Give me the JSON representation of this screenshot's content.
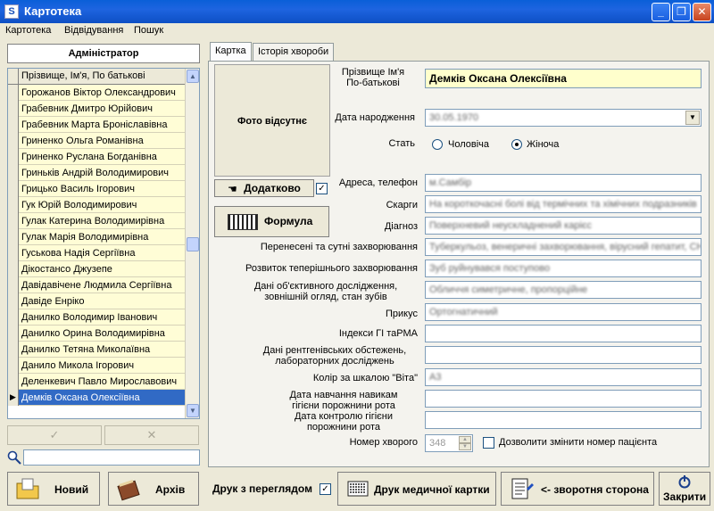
{
  "window": {
    "title": "Картотека"
  },
  "menu": [
    "Картотека",
    "Відвідування",
    "Пошук"
  ],
  "left": {
    "admin": "Адміністратор",
    "header": "Прізвище, Ім'я, По батькові",
    "patients": [
      "Горожанов Віктор Олександрович",
      "Грабевник Дмитро Юрійович",
      "Грабевник Марта Броніславівна",
      "Гриненко Ольга Романівна",
      "Гриненко Руслана Богданівна",
      "Гриньків Андрій Володимирович",
      "Грицько Василь Ігорович",
      "Гук Юрій Володимирович",
      "Гулак Катерина  Володимирівна",
      "Гулак Марія Володимирівна",
      "Гуськова Надія Сергіївна",
      "Дікостансо Джузепе",
      "Давідавічене  Людмила  Сергіївна",
      "Давіде Енріко",
      "Данилко Володимир Іванович",
      "Данилко Орина Володимирівна",
      "Данилко Тетяна Миколаївна",
      "Данило Микола Ігорович",
      "Деленкевич Павло Мирославович",
      "Демків Оксана Олексіївна"
    ],
    "selected_index": 19,
    "confirm_glyph": "✓",
    "cancel_glyph": "✕"
  },
  "tabs": [
    "Картка",
    "Історія хвороби"
  ],
  "card": {
    "photo": "Фото відсутнє",
    "dodatkovo": "Додатково",
    "formula": "Формула",
    "labels": {
      "name": "Прізвище Ім'я\nПо-батькові",
      "birth": "Дата народження",
      "sex": "Стать",
      "address": "Адреса, телефон",
      "complaints": "Скарги",
      "diagnosis": "Діагноз",
      "past_diseases": "Перенесені та сутні захворювання",
      "current_disease": "Розвиток теперішнього захворювання",
      "objective": "Дані об'єктивного дослідження,\nзовнішній огляд, стан зубів",
      "bite": "Прикус",
      "indices": "Індекси ГІ таРМА",
      "xray": "Дані рентгенівських обстежень,\nлабораторних досліджень",
      "vita": "Колір за шкалою \"Віта\"",
      "hygiene_training": "Дата навчання навикам\nгігієни порожнини рота",
      "hygiene_control": "Дата контролю гігієни\nпорожнини рота",
      "patient_no": "Номер хворого"
    },
    "values": {
      "name": "Демків Оксана Олексіївна",
      "birth": "30.05.1970",
      "address": "м.Самбір",
      "complaints": "На короткочасні болі від термічних та хімічних подразників",
      "diagnosis": "Поверхневий неускладнений карієс",
      "past_diseases": "Туберкульоз, венеричні захворювання, вірусний гепатит, СНІД",
      "current_disease": "Зуб руйнувався поступово",
      "objective": "Обличчя симетричне, пропорційне",
      "bite": "Ортогнатичний",
      "indices": "",
      "xray": "",
      "vita": "А3",
      "hygiene_training": "",
      "hygiene_control": "",
      "patient_no": "348"
    },
    "sex_options": [
      "Чоловіча",
      "Жіноча"
    ],
    "sex_selected": "Жіноча",
    "allow_change_no": "Дозволити змінити номер пацієнта"
  },
  "toolbar": {
    "new": "Новий",
    "archive": "Архів",
    "print_preview": "Друк з переглядом",
    "print_card": "Друк медичної картки",
    "back_side": "<- зворотня сторона",
    "close": "Закрити"
  },
  "colors": {
    "selection": "#316ac5",
    "row_bg": "#fffdd6",
    "name_bg": "#ffffcc",
    "title_bar": "#0a5fd8"
  }
}
